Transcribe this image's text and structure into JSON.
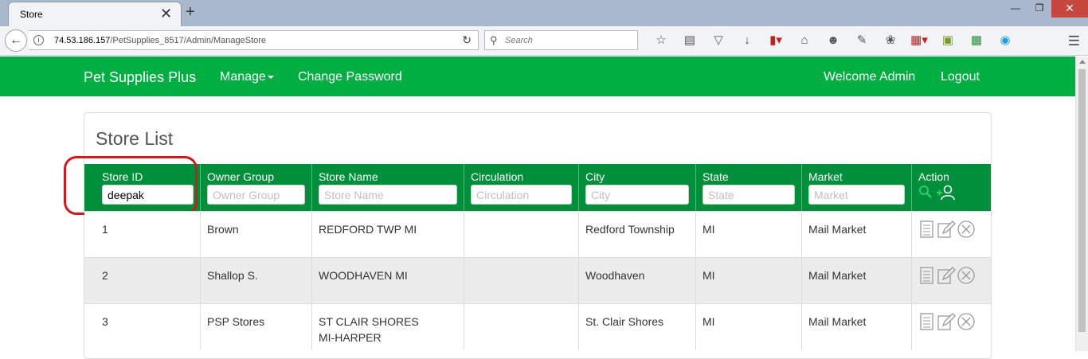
{
  "browser": {
    "tab_title": "Store",
    "tab_close": "✕",
    "new_tab": "+",
    "url_host": "74.53.186.157",
    "url_path": "/PetSupplies_8517/Admin/ManageStore",
    "search_placeholder": "Search",
    "window_controls": [
      "—",
      "❐",
      "✕"
    ],
    "toolbar_icons": [
      "star-icon",
      "reading-list-icon",
      "pocket-icon",
      "download-icon",
      "flash-icon",
      "home-icon",
      "emoji-icon",
      "clipboard-icon",
      "bug-icon",
      "new-badge-icon",
      "addon-icon",
      "spreadsheet-icon",
      "skype-icon"
    ]
  },
  "site_nav": {
    "brand": "Pet Supplies Plus",
    "manage": "Manage",
    "change_password": "Change Password",
    "welcome": "Welcome Admin",
    "logout": "Logout"
  },
  "page": {
    "title": "Store List"
  },
  "table": {
    "columns": [
      {
        "label": "Store ID",
        "placeholder": "Store ID",
        "value": "deepak"
      },
      {
        "label": "Owner Group",
        "placeholder": "Owner Group",
        "value": ""
      },
      {
        "label": "Store Name",
        "placeholder": "Store Name",
        "value": ""
      },
      {
        "label": "Circulation",
        "placeholder": "Circulation",
        "value": ""
      },
      {
        "label": "City",
        "placeholder": "City",
        "value": ""
      },
      {
        "label": "State",
        "placeholder": "State",
        "value": ""
      },
      {
        "label": "Market",
        "placeholder": "Market",
        "value": ""
      },
      {
        "label": "Action"
      }
    ],
    "rows": [
      {
        "store_id": "1",
        "owner_group": "Brown",
        "store_name": "REDFORD TWP MI",
        "circulation": "",
        "city": "Redford Township",
        "state": "MI",
        "market": "Mail Market"
      },
      {
        "store_id": "2",
        "owner_group": "Shallop S.",
        "store_name": "WOODHAVEN MI",
        "circulation": "",
        "city": "Woodhaven",
        "state": "MI",
        "market": "Mail Market"
      },
      {
        "store_id": "3",
        "owner_group": "PSP Stores",
        "store_name": "ST CLAIR SHORES MI-HARPER",
        "circulation": "",
        "city": "St. Clair Shores",
        "state": "MI",
        "market": "Mail Market"
      }
    ]
  },
  "colors": {
    "nav_green": "#00ae42",
    "header_green": "#008f3b",
    "highlight_red": "#d11a1a"
  }
}
